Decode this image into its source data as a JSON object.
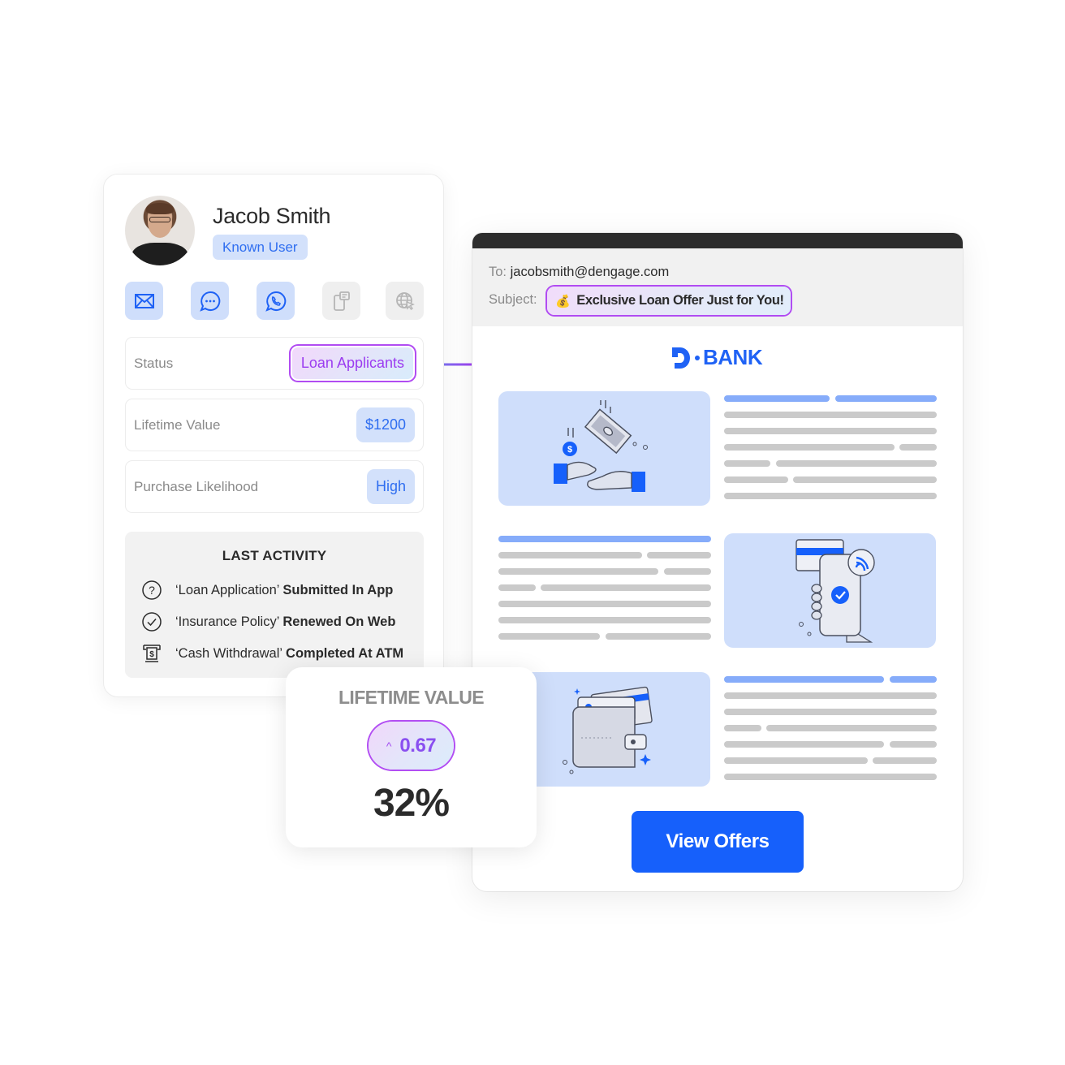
{
  "profile": {
    "name": "Jacob Smith",
    "badge": "Known User",
    "channels": [
      {
        "icon": "email-icon",
        "active": true
      },
      {
        "icon": "chat-bubble-icon",
        "active": true
      },
      {
        "icon": "whatsapp-icon",
        "active": true
      },
      {
        "icon": "sms-phone-icon",
        "active": false
      },
      {
        "icon": "web-push-icon",
        "active": false
      }
    ],
    "attributes": [
      {
        "label": "Status",
        "value": "Loan Applicants"
      },
      {
        "label": "Lifetime Value",
        "value": "$1200"
      },
      {
        "label": "Purchase Likelihood",
        "value": "High"
      }
    ],
    "last_activity": {
      "title": "LAST ACTIVITY",
      "items": [
        {
          "icon": "question-circle-icon",
          "subject": "‘Loan Application’",
          "action": "Submitted In App"
        },
        {
          "icon": "check-circle-icon",
          "subject": "‘Insurance Policy’",
          "action": "Renewed On Web"
        },
        {
          "icon": "atm-cash-icon",
          "subject": "‘Cash Withdrawal’",
          "action": "Completed At ATM"
        }
      ]
    }
  },
  "email": {
    "to_label": "To:",
    "to_value": "jacobsmith@dengage.com",
    "subject_label": "Subject:",
    "subject_emoji": "💰",
    "subject_value": "Exclusive Loan Offer Just for You!",
    "brand": "BANK",
    "sections": [
      {
        "illustration": "hands-money-icon"
      },
      {
        "illustration": "phone-contactless-payment-icon"
      },
      {
        "illustration": "wallet-cards-icon"
      }
    ],
    "cta_label": "View Offers"
  },
  "ltv_card": {
    "title": "LIFETIME VALUE",
    "change_arrow": "^",
    "change_value": "0.67",
    "percent": "32%"
  },
  "colors": {
    "brand_blue": "#1660fb",
    "chip_blue_bg": "#d3e1fb",
    "accent_purple": "#b14cf2"
  }
}
